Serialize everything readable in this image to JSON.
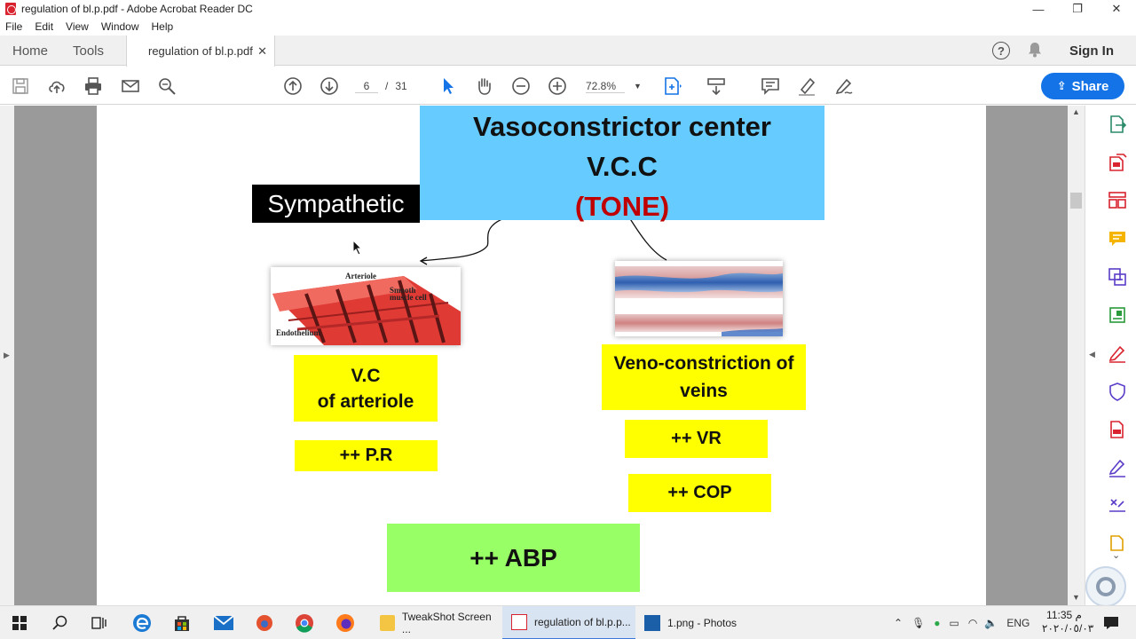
{
  "window": {
    "title": "regulation of bl.p.pdf - Adobe Acrobat Reader DC",
    "minimize": "—",
    "maximize": "❐",
    "close": "✕"
  },
  "menu": [
    "File",
    "Edit",
    "View",
    "Window",
    "Help"
  ],
  "tabs": {
    "home": "Home",
    "tools": "Tools",
    "document": "regulation of bl.p.pdf",
    "close": "✕"
  },
  "header": {
    "help": "?",
    "sign_in": "Sign In"
  },
  "toolbar": {
    "current_page": "6",
    "page_separator": "/",
    "total_pages": "31",
    "zoom": "72.8%",
    "share_label": "Share"
  },
  "slide": {
    "center_title_line1": "Vasoconstrictor center",
    "center_title_line2": "V.C.C",
    "center_title_line3": "(TONE)",
    "sympathetic": "Sympathetic",
    "arteriole_labels": {
      "arteriole": "Arteriole",
      "smooth": "Smooth",
      "muscle_cell": "muscle cell",
      "endothelium": "Endothelium"
    },
    "vc_arteriole_line1": "V.C",
    "vc_arteriole_line2": "of arteriole",
    "pr": "++ P.R",
    "veno_constriction": "Veno-constriction of veins",
    "vr": "++ VR",
    "cop": "++ COP",
    "abp": "++ ABP"
  },
  "taskbar": {
    "apps": [
      {
        "label": "TweakShot Screen ..."
      },
      {
        "label": "regulation of bl.p.p..."
      },
      {
        "label": "1.png - Photos"
      }
    ],
    "language": "ENG",
    "time": "11:35 م",
    "date": "٢٠٢٠/٠٥/٠٣"
  },
  "colors": {
    "center_box": "#66ccff",
    "tone_text": "#c00000",
    "result_boxes": "#ffff00",
    "abp_box": "#99ff66",
    "share_button": "#1473e6"
  }
}
